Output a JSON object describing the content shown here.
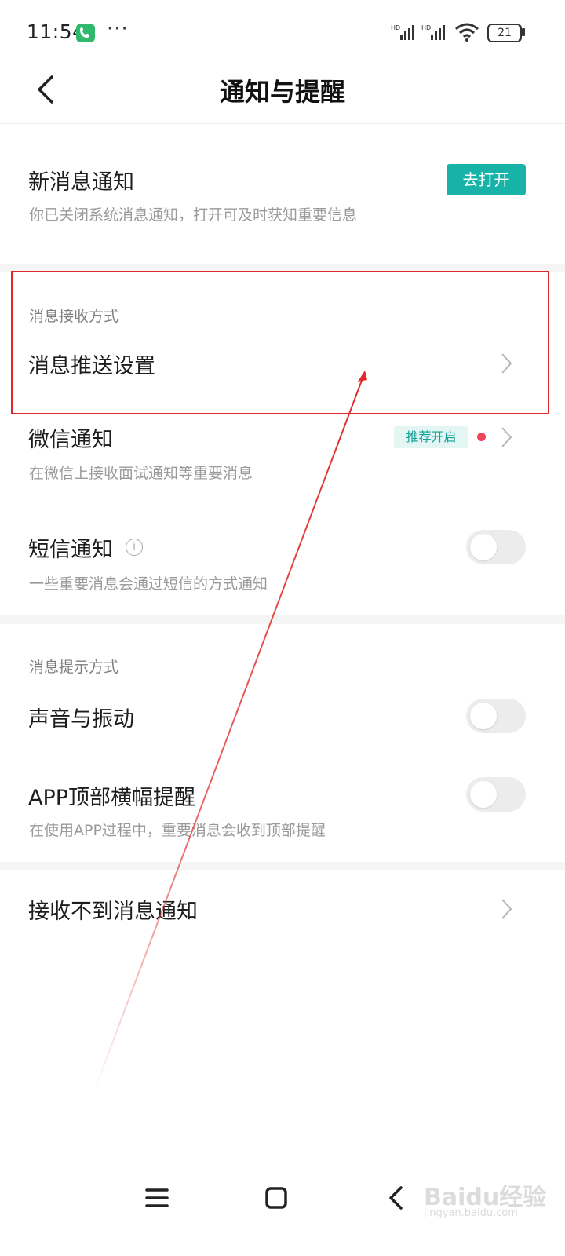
{
  "status_bar": {
    "time": "11:54",
    "dots": "···",
    "signal1": "HD",
    "signal2": "HD",
    "battery": "21"
  },
  "header": {
    "title": "通知与提醒"
  },
  "new_message": {
    "title": "新消息通知",
    "subtitle": "你已关闭系统消息通知，打开可及时获知重要信息",
    "button_label": "去打开"
  },
  "receive_section": {
    "label": "消息接收方式",
    "items": [
      {
        "title": "消息推送设置"
      },
      {
        "title": "微信通知",
        "subtitle": "在微信上接收面试通知等重要消息",
        "badge": "推荐开启"
      },
      {
        "title": "短信通知",
        "subtitle": "一些重要消息会通过短信的方式通知",
        "toggle_on": false
      }
    ]
  },
  "prompt_section": {
    "label": "消息提示方式",
    "items": [
      {
        "title": "声音与振动",
        "toggle_on": false
      },
      {
        "title": "APP顶部横幅提醒",
        "subtitle": "在使用APP过程中，重要消息会收到顶部提醒",
        "toggle_on": false
      }
    ]
  },
  "help_item": {
    "title": "接收不到消息通知"
  },
  "watermark": {
    "main": "Baidu经验",
    "sub": "jingyan.baidu.com"
  },
  "colors": {
    "accent": "#17b3a8",
    "highlight": "#e02a2a",
    "badge_bg": "#e3f6f4",
    "red_dot": "#f0445a"
  }
}
